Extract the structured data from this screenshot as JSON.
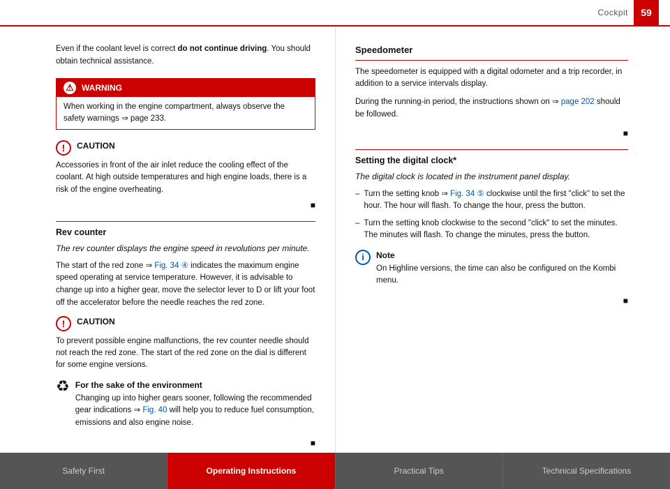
{
  "header": {
    "title": "Cockpit",
    "page_number": "59"
  },
  "left_column": {
    "intro_text_part1": "Even if the coolant level is correct ",
    "intro_bold": "do not continue driving",
    "intro_text_part2": ". You should obtain technical assistance.",
    "warning": {
      "label": "WARNING",
      "body": "When working in the engine compartment, always observe the safety warnings ⇒ page 233."
    },
    "caution1": {
      "label": "CAUTION",
      "text": "Accessories in front of the air inlet reduce the cooling effect of the coolant. At high outside temperatures and high engine loads, there is a risk of the engine overheating."
    },
    "rev_counter": {
      "heading": "Rev counter",
      "italic": "The rev counter displays the engine speed in revolutions per minute.",
      "body": "The start of the red zone ⇒ Fig. 34 ④ indicates the maximum engine speed operating at service temperature. However, it is advisable to change up into a higher gear, move the selector lever to D or lift your foot off the accelerator before the needle reaches the red zone."
    },
    "caution2": {
      "label": "CAUTION",
      "text": "To prevent possible engine malfunctions, the rev counter needle should not reach the red zone. The start of the red zone on the dial is different for some engine versions."
    },
    "environment": {
      "label": "For the sake of the environment",
      "text": "Changing up into higher gears sooner, following the recommended gear indications ⇒ Fig. 40 will help you to reduce fuel consumption, emissions and also engine noise."
    }
  },
  "right_column": {
    "speedometer": {
      "heading": "Speedometer",
      "text1": "The speedometer is equipped with a digital odometer and a trip recorder, in addition to a service intervals display.",
      "text2": "During the running-in period, the instructions shown on ⇒ page 202 should be followed."
    },
    "digital_clock": {
      "heading": "Setting the digital clock*",
      "italic": "The digital clock is located in the instrument panel display.",
      "step1": "Turn the setting knob ⇒ Fig. 34 ⑤ clockwise until the first \"click\" to set the hour. The hour will flash. To change the hour, press the button.",
      "step2": "Turn the setting knob clockwise to the second \"click\" to set the minutes. The minutes will flash. To change the minutes, press the button.",
      "note": {
        "label": "Note",
        "text": "On Highline versions, the time can also be configured on the Kombi menu."
      }
    }
  },
  "footer": {
    "tabs": [
      {
        "label": "Safety First",
        "active": false
      },
      {
        "label": "Operating Instructions",
        "active": true
      },
      {
        "label": "Practical Tips",
        "active": false
      },
      {
        "label": "Technical Specifications",
        "active": false
      }
    ]
  }
}
